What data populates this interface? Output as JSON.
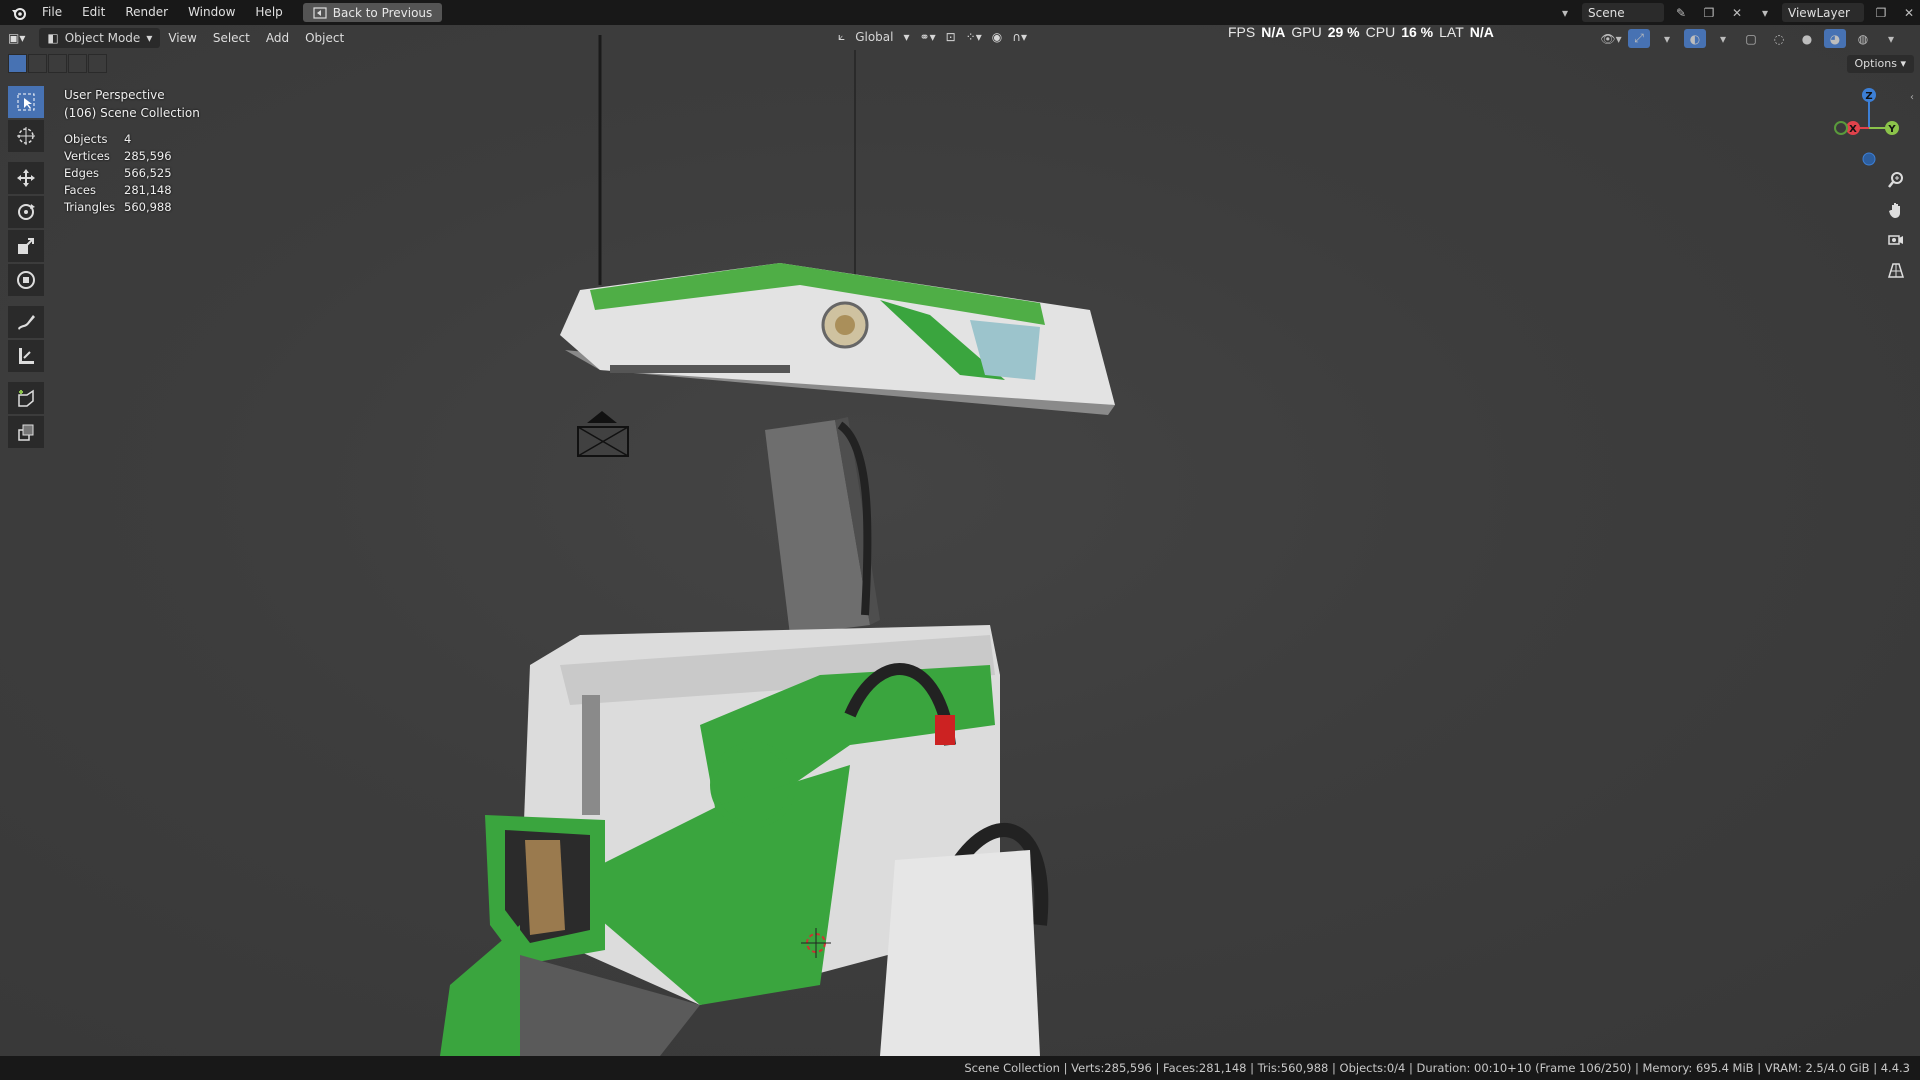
{
  "menubar": {
    "items": [
      "File",
      "Edit",
      "Render",
      "Window",
      "Help"
    ],
    "back_button": "Back to Previous",
    "scene_name": "Scene",
    "view_layer": "ViewLayer"
  },
  "viewport_header": {
    "mode": "Object Mode",
    "menus": [
      "View",
      "Select",
      "Add",
      "Object"
    ],
    "orientation": "Global",
    "options": "Options"
  },
  "perf": {
    "fps_label": "FPS",
    "fps_value": "N/A",
    "gpu_label": "GPU",
    "gpu_value": "29 %",
    "cpu_label": "CPU",
    "cpu_value": "16 %",
    "lat_label": "LAT",
    "lat_value": "N/A"
  },
  "overlay": {
    "view_name": "User Perspective",
    "collection": "(106) Scene Collection",
    "stats": [
      {
        "label": "Objects",
        "value": "4"
      },
      {
        "label": "Vertices",
        "value": "285,596"
      },
      {
        "label": "Edges",
        "value": "566,525"
      },
      {
        "label": "Faces",
        "value": "281,148"
      },
      {
        "label": "Triangles",
        "value": "560,988"
      }
    ]
  },
  "gizmo": {
    "x": "X",
    "y": "Y",
    "z": "Z"
  },
  "tools": [
    "select-box-tool",
    "cursor-tool",
    "move-tool",
    "rotate-tool",
    "scale-tool",
    "transform-tool",
    "annotate-tool",
    "measure-tool",
    "add-cube-tool",
    "extrude-tool"
  ],
  "status": {
    "text": "Scene Collection | Verts:285,596 | Faces:281,148 | Tris:560,988 | Objects:0/4 | Duration: 00:10+10 (Frame 106/250) | Memory: 695.4 MiB | VRAM: 2.5/4.0 GiB | 4.4.3"
  },
  "colors": {
    "accent": "#4772b3",
    "robot_green": "#3aa53e",
    "robot_white": "#d9d9d9",
    "axis_x": "#e0424b",
    "axis_y": "#8bc34a",
    "axis_z": "#3c7fd6"
  }
}
